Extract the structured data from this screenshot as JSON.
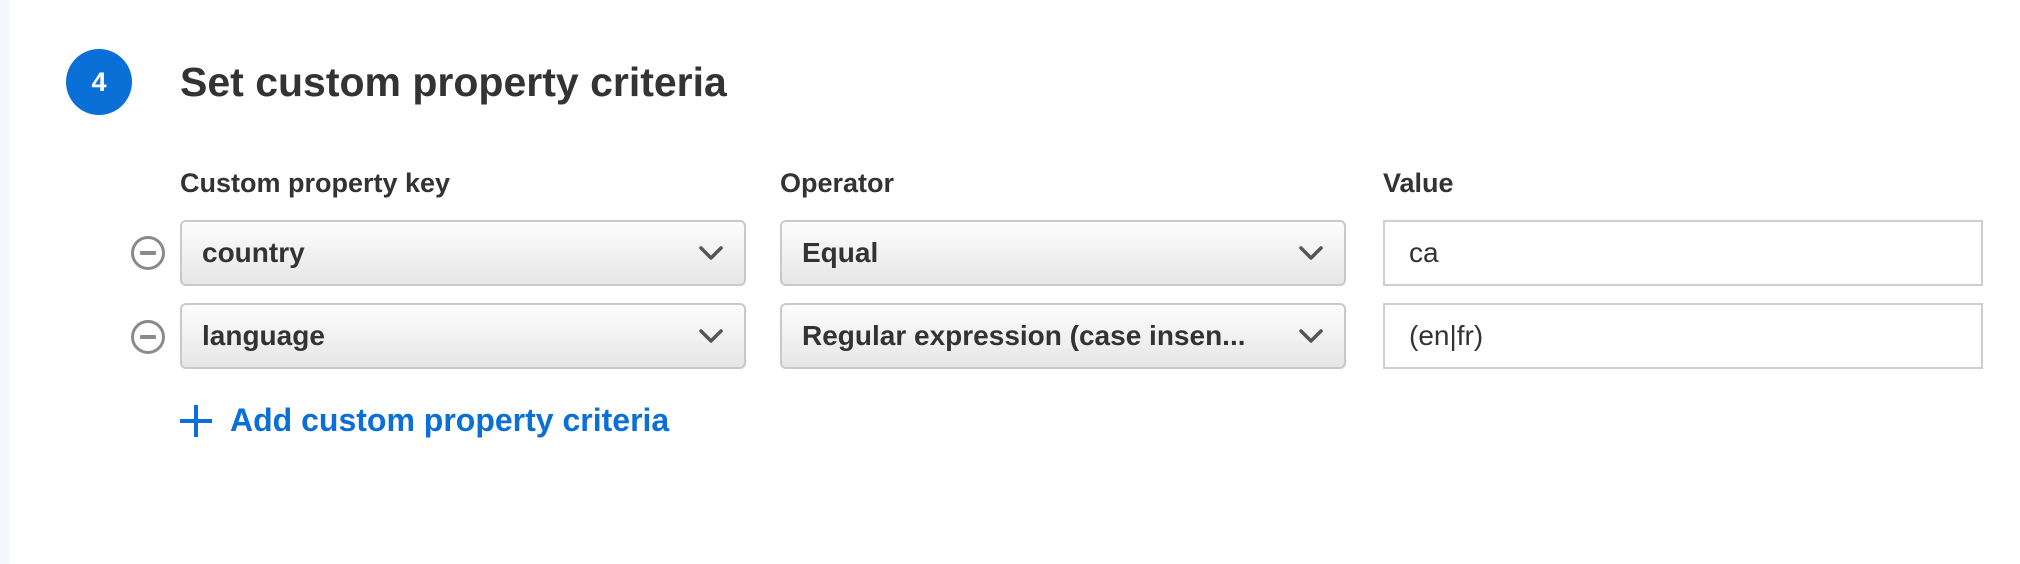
{
  "section": {
    "step_number": "4",
    "title": "Set custom property criteria"
  },
  "columns": {
    "key": "Custom property key",
    "operator": "Operator",
    "value": "Value"
  },
  "criteria": [
    {
      "key": "country",
      "operator": "Equal",
      "value": "ca"
    },
    {
      "key": "language",
      "operator": "Regular expression (case insen...",
      "value": "(en|fr)"
    }
  ],
  "add_link": {
    "label": "Add custom property criteria"
  },
  "icons": {
    "remove": "minus-circle-icon",
    "dropdown": "chevron-down-icon",
    "add": "plus-icon"
  },
  "colors": {
    "accent": "#0a6fd6",
    "text": "#333333",
    "icon_gray": "#8a8a8a"
  }
}
